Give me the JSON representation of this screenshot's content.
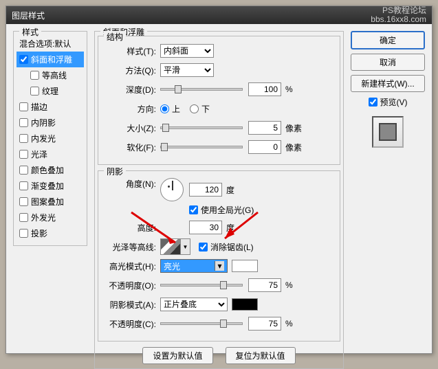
{
  "window": {
    "title": "图层样式",
    "watermark1": "PS教程论坛",
    "watermark2": "bbs.16xx8.com"
  },
  "styles": {
    "legend": "样式",
    "items": [
      {
        "label": "混合选项:默认",
        "heading": true
      },
      {
        "label": "斜面和浮雕",
        "checked": true,
        "selected": true
      },
      {
        "label": "等高线",
        "checked": false,
        "indent": true
      },
      {
        "label": "纹理",
        "checked": false,
        "indent": true
      },
      {
        "label": "描边",
        "checked": false
      },
      {
        "label": "内阴影",
        "checked": false
      },
      {
        "label": "内发光",
        "checked": false
      },
      {
        "label": "光泽",
        "checked": false
      },
      {
        "label": "颜色叠加",
        "checked": false
      },
      {
        "label": "渐变叠加",
        "checked": false
      },
      {
        "label": "图案叠加",
        "checked": false
      },
      {
        "label": "外发光",
        "checked": false
      },
      {
        "label": "投影",
        "checked": false
      }
    ]
  },
  "bevel": {
    "legend": "斜面和浮雕",
    "structure": {
      "legend": "结构",
      "style_label": "样式(T):",
      "style_value": "内斜面",
      "technique_label": "方法(Q):",
      "technique_value": "平滑",
      "depth_label": "深度(D):",
      "depth_value": "100",
      "depth_unit": "%",
      "direction_label": "方向:",
      "dir_up": "上",
      "dir_down": "下",
      "size_label": "大小(Z):",
      "size_value": "5",
      "size_unit": "像素",
      "soften_label": "软化(F):",
      "soften_value": "0",
      "soften_unit": "像素"
    },
    "shading": {
      "legend": "阴影",
      "angle_label": "角度(N):",
      "angle_value": "120",
      "angle_unit": "度",
      "global_label": "使用全局光(G)",
      "altitude_label": "高度:",
      "altitude_value": "30",
      "altitude_unit": "度",
      "contour_label": "光泽等高线:",
      "antialias_label": "消除锯齿(L)",
      "hl_mode_label": "高光模式(H):",
      "hl_mode_value": "亮光",
      "hl_opacity_label": "不透明度(O):",
      "hl_opacity_value": "75",
      "hl_opacity_unit": "%",
      "sh_mode_label": "阴影模式(A):",
      "sh_mode_value": "正片叠底",
      "sh_opacity_label": "不透明度(C):",
      "sh_opacity_value": "75",
      "sh_opacity_unit": "%"
    },
    "defaults": {
      "make": "设置为默认值",
      "reset": "复位为默认值"
    }
  },
  "buttons": {
    "ok": "确定",
    "cancel": "取消",
    "new_style": "新建样式(W)...",
    "preview": "预览(V)"
  }
}
